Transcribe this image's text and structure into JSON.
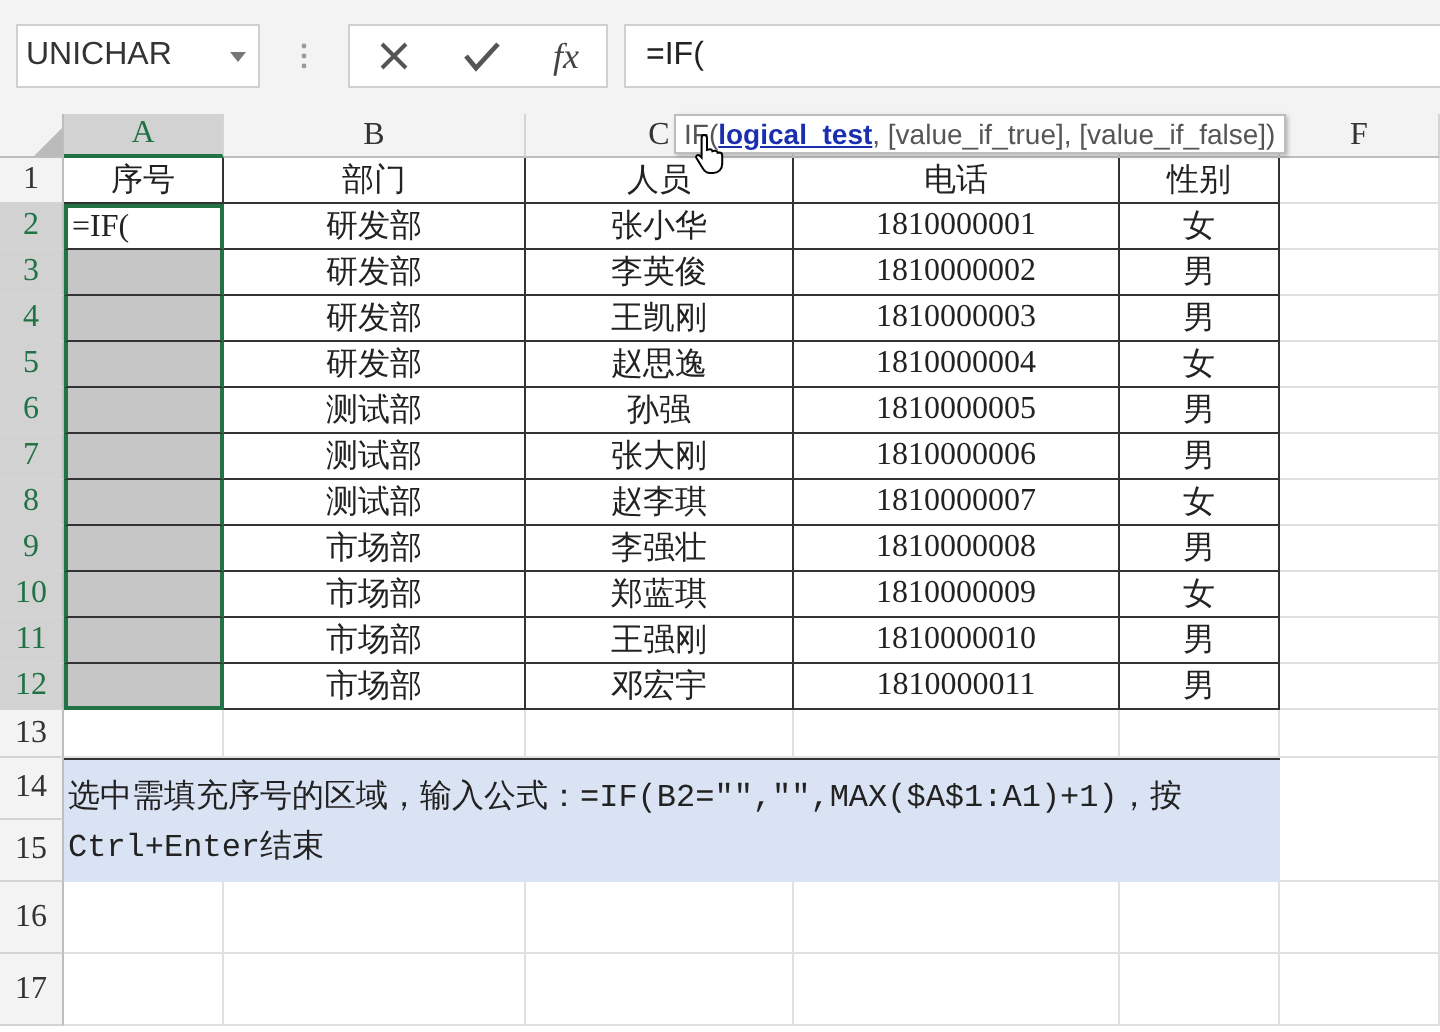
{
  "name_box": {
    "value": "UNICHAR"
  },
  "formula_bar": {
    "fx_label": "fx",
    "value": "=IF("
  },
  "tooltip": {
    "text": "IF(**logical_test**, [value_if_true], [value_if_false])"
  },
  "columns": [
    {
      "label": "A",
      "selected": true
    },
    {
      "label": "B",
      "selected": false
    },
    {
      "label": "C",
      "selected": false
    },
    {
      "selected": false
    },
    {
      "selected": false
    },
    {
      "label": "F",
      "selected": false
    }
  ],
  "rows": [
    {
      "header": "1",
      "selected": false,
      "cells": [
        "序号",
        "部门",
        "人员",
        "电话",
        "性别"
      ]
    },
    {
      "header": "2",
      "selected": true,
      "cells": [
        "=IF(",
        "研发部",
        "张小华",
        "1810000001",
        "女"
      ]
    },
    {
      "header": "3",
      "selected": true,
      "cells": [
        "",
        "研发部",
        "李英俊",
        "1810000002",
        "男"
      ]
    },
    {
      "header": "4",
      "selected": true,
      "cells": [
        "",
        "研发部",
        "王凯刚",
        "1810000003",
        "男"
      ]
    },
    {
      "header": "5",
      "selected": true,
      "cells": [
        "",
        "研发部",
        "赵思逸",
        "1810000004",
        "女"
      ]
    },
    {
      "header": "6",
      "selected": true,
      "cells": [
        "",
        "测试部",
        "孙强",
        "1810000005",
        "男"
      ]
    },
    {
      "header": "7",
      "selected": true,
      "cells": [
        "",
        "测试部",
        "张大刚",
        "1810000006",
        "男"
      ]
    },
    {
      "header": "8",
      "selected": true,
      "cells": [
        "",
        "测试部",
        "赵李琪",
        "1810000007",
        "女"
      ]
    },
    {
      "header": "9",
      "selected": true,
      "cells": [
        "",
        "市场部",
        "李强壮",
        "1810000008",
        "男"
      ]
    },
    {
      "header": "10",
      "selected": true,
      "cells": [
        "",
        "市场部",
        "郑蓝琪",
        "1810000009",
        "女"
      ]
    },
    {
      "header": "11",
      "selected": true,
      "cells": [
        "",
        "市场部",
        "王强刚",
        "1810000010",
        "男"
      ]
    },
    {
      "header": "12",
      "selected": true,
      "cells": [
        "",
        "市场部",
        "邓宏宇",
        "1810000011",
        "男"
      ]
    }
  ],
  "blank_rows_before": [
    "13"
  ],
  "note": {
    "headers": [
      "14",
      "15"
    ],
    "text": "选中需填充序号的区域，输入公式：=IF(B2=\"\",\"\",MAX($A$1:A1)+1)，按Ctrl+Enter结束"
  },
  "blank_rows_after": [
    "16",
    "17"
  ]
}
